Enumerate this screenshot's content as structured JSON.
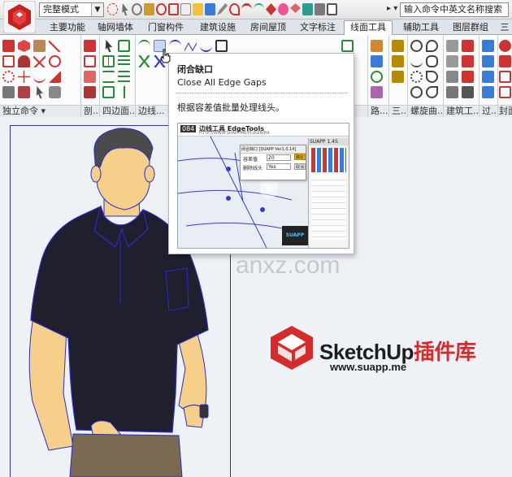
{
  "toolbar": {
    "mode_value": "完整模式",
    "command_placeholder": "输入命令中英文名称搜索"
  },
  "tabs": [
    "主要功能",
    "轴网墙体",
    "门窗构件",
    "建筑设施",
    "房间屋顶",
    "文字标注",
    "线面工具",
    "辅助工具",
    "图层群组",
    "三"
  ],
  "active_tab": "线面工具",
  "groups": [
    {
      "label": "独立命令 ▾"
    },
    {
      "label": "剖..."
    },
    {
      "label": "四边面..."
    },
    {
      "label": "边线..."
    },
    {
      "label": "路..."
    },
    {
      "label": "三..."
    },
    {
      "label": "螺旋曲..."
    },
    {
      "label": "建筑工..."
    },
    {
      "label": "过..."
    },
    {
      "label": "封面"
    }
  ],
  "tooltip": {
    "title": "闭合缺口",
    "english": "Close All Edge Gaps",
    "description": "根据容差值批量处理线头。",
    "preview": {
      "badge": "084",
      "heading": "边线工具 EdgeTools",
      "url": "HTTP://WWW.SUAPP.ME/PLUGIN/84",
      "panel_title": "SUAPP 1.4S",
      "dialog_title": "闭合缺口 [SUAPP Ver1.0.14]",
      "dialog_row1_label": "容差值",
      "dialog_row1_value": "20",
      "dialog_row2_label": "删除线头",
      "dialog_row2_value": "Yes",
      "ok_label": "确定",
      "cancel_label": "取消",
      "bottom_logo": "SUAPP"
    }
  },
  "branding": {
    "brand_latin": "SketchUp",
    "brand_cn": "插件库",
    "url": "www.suapp.me"
  },
  "watermark": "anxz.com",
  "colors": {
    "brand_red": "#d42b2b",
    "guide_blue": "#2b2bd0",
    "shirt": "#1f1f2e",
    "skin": "#f6d08a"
  }
}
